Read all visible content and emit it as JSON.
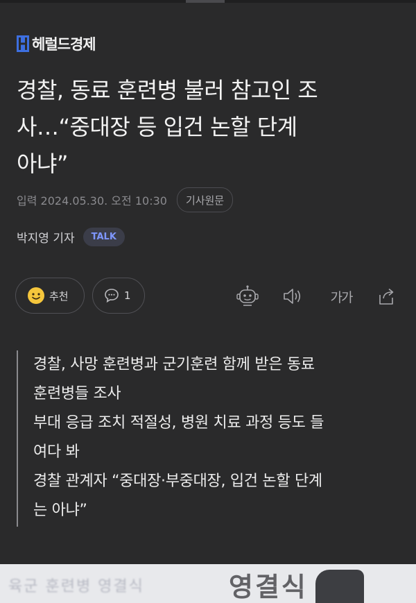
{
  "brand": {
    "name": "헤럴드경제"
  },
  "article": {
    "headline_lines": [
      "경찰, 동료 훈련병 불러 참고인 조",
      "사…“중대장 등 입건 논할 단계",
      "아냐”"
    ],
    "date": "입력 2024.05.30. 오전 10:30",
    "source_button": "기사원문",
    "author": "박지영 기자",
    "talk_badge": "TALK"
  },
  "actions": {
    "recommend_label": "추천",
    "comment_count": "1",
    "font_label": "가가"
  },
  "summary": {
    "lines": [
      "경찰, 사망 훈련병과 군기훈련 함께 받은 동료",
      "훈련병들 조사",
      "부대 응급 조치 적절성, 병원 치료 과정 등도 들",
      "여다 봐",
      "경찰 관계자 “중대장·부중대장, 입건 논할 단계",
      "는 아냐”"
    ]
  },
  "photo": {
    "banner_text": "영결식 거",
    "background_text": "육군 훈련병 영결식"
  },
  "colors": {
    "background": "#2a2a2b",
    "talk_badge_text": "#7f97ff",
    "logo_blue": "#3d6fe0"
  }
}
